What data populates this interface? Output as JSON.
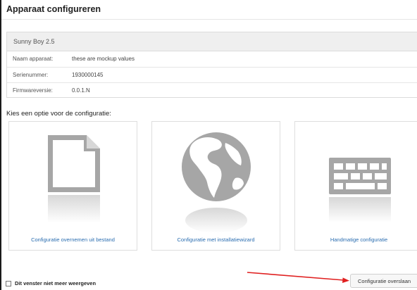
{
  "dialog": {
    "title": "Apparaat configureren"
  },
  "device": {
    "model": "Sunny Boy 2.5",
    "rows": [
      {
        "label": "Naam apparaat:",
        "value": "these are mockup values"
      },
      {
        "label": "Serienummer:",
        "value": "1930000145"
      },
      {
        "label": "Firmwareversie:",
        "value": "0.0.1.N"
      }
    ]
  },
  "options": {
    "prompt": "Kies een optie voor de configuratie:",
    "cards": [
      {
        "label": "Configuratie overnemen uit bestand",
        "icon": "document-icon"
      },
      {
        "label": "Configuratie met installatiewizard",
        "icon": "globe-icon"
      },
      {
        "label": "Handmatige configuratie",
        "icon": "keyboard-icon"
      }
    ]
  },
  "footer": {
    "checkbox_label": "Dit venster niet meer weergeven",
    "skip_label": "Configuratie overslaan"
  },
  "colors": {
    "link": "#2a6db0",
    "icon_gray": "#a6a6a6",
    "arrow": "#e02020"
  }
}
